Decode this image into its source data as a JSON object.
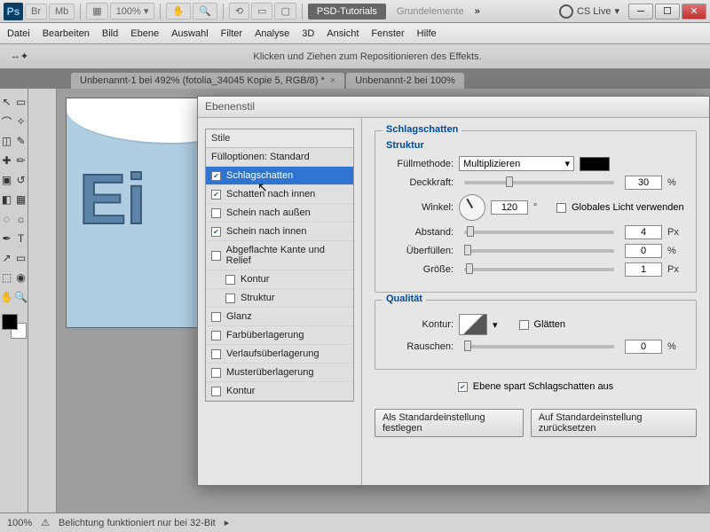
{
  "app_bar": {
    "ps": "Ps",
    "br": "Br",
    "mb": "Mb",
    "zoom": "100%",
    "tab_active": "PSD-Tutorials",
    "tab_inactive": "Grundelemente",
    "more": "»",
    "cs_live": "CS Live"
  },
  "menu": [
    "Datei",
    "Bearbeiten",
    "Bild",
    "Ebene",
    "Auswahl",
    "Filter",
    "Analyse",
    "3D",
    "Ansicht",
    "Fenster",
    "Hilfe"
  ],
  "opt_bar_msg": "Klicken und Ziehen zum Repositionieren des Effekts.",
  "doc_tabs": [
    "Unbenannt-1 bei 492% (fotolia_34045 Kopie 5, RGB/8) *",
    "Unbenannt-2 bei 100%"
  ],
  "canvas_text": "Ei",
  "dialog": {
    "title": "Ebenenstil",
    "styles_header": "Stile",
    "fulloptions": "Fülloptionen: Standard",
    "items": [
      {
        "label": "Schlagschatten",
        "checked": true,
        "active": true
      },
      {
        "label": "Schatten nach innen",
        "checked": true
      },
      {
        "label": "Schein nach außen",
        "checked": false
      },
      {
        "label": "Schein nach innen",
        "checked": true
      },
      {
        "label": "Abgeflachte Kante und Relief",
        "checked": false
      },
      {
        "label": "Kontur",
        "checked": false,
        "sub": true
      },
      {
        "label": "Struktur",
        "checked": false,
        "sub": true
      },
      {
        "label": "Glanz",
        "checked": false
      },
      {
        "label": "Farbüberlagerung",
        "checked": false
      },
      {
        "label": "Verlaufsüberlagerung",
        "checked": false
      },
      {
        "label": "Musterüberlagerung",
        "checked": false
      },
      {
        "label": "Kontur",
        "checked": false
      }
    ],
    "panel_title": "Schlagschatten",
    "struktur": "Struktur",
    "qualitat": "Qualität",
    "labels": {
      "fullmethode": "Füllmethode:",
      "deckkraft": "Deckkraft:",
      "winkel": "Winkel:",
      "global": "Globales Licht verwenden",
      "abstand": "Abstand:",
      "uberfullen": "Überfüllen:",
      "grosse": "Größe:",
      "kontur": "Kontur:",
      "glatten": "Glätten",
      "rauschen": "Rauschen:",
      "knockout": "Ebene spart Schlagschatten aus"
    },
    "values": {
      "fullmethode": "Multiplizieren",
      "deckkraft": "30",
      "winkel": "120",
      "abstand": "4",
      "uberfullen": "0",
      "grosse": "1",
      "rauschen": "0"
    },
    "units": {
      "pct": "%",
      "px": "Px",
      "deg": "°"
    },
    "buttons": {
      "default_set": "Als Standardeinstellung festlegen",
      "default_reset": "Auf Standardeinstellung zurücksetzen"
    }
  },
  "status": {
    "zoom": "100%",
    "msg": "Belichtung funktioniert nur bei 32-Bit"
  }
}
